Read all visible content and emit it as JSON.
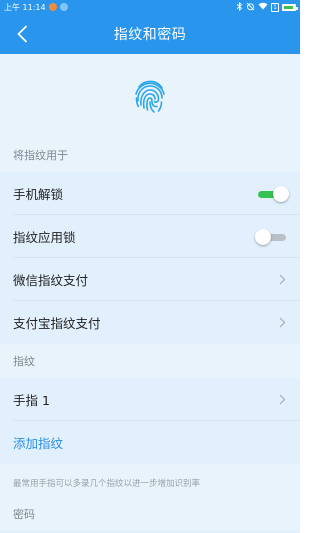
{
  "status_bar": {
    "time": "上午 11:14",
    "dot_colors": [
      "#f08a3c",
      "#7fc6f5"
    ],
    "icons": [
      "bluetooth-icon",
      "alarm-off-icon",
      "wifi-icon",
      "sim-icon",
      "battery-icon"
    ],
    "sim_label": "1"
  },
  "nav": {
    "title": "指纹和密码",
    "back_icon": "chevron-left-icon"
  },
  "hero": {
    "icon": "fingerprint-icon",
    "accent_color": "#2aa6e8"
  },
  "usage_section": {
    "header": "将指纹用于",
    "items": [
      {
        "label": "手机解锁",
        "control": "toggle",
        "state": "on"
      },
      {
        "label": "指纹应用锁",
        "control": "toggle",
        "state": "off"
      },
      {
        "label": "微信指纹支付",
        "control": "chevron"
      },
      {
        "label": "支付宝指纹支付",
        "control": "chevron"
      }
    ]
  },
  "fingerprint_section": {
    "header": "指纹",
    "items": [
      {
        "label": "手指 1",
        "control": "chevron"
      },
      {
        "label": "添加指纹",
        "control": "link"
      }
    ],
    "footnote": "最常用手指可以多录几个指纹以进一步增加识别率"
  },
  "password_section": {
    "header": "密码"
  },
  "colors": {
    "primary": "#2a95ec",
    "toggle_on": "#36c150",
    "link": "#2a8ee6"
  }
}
